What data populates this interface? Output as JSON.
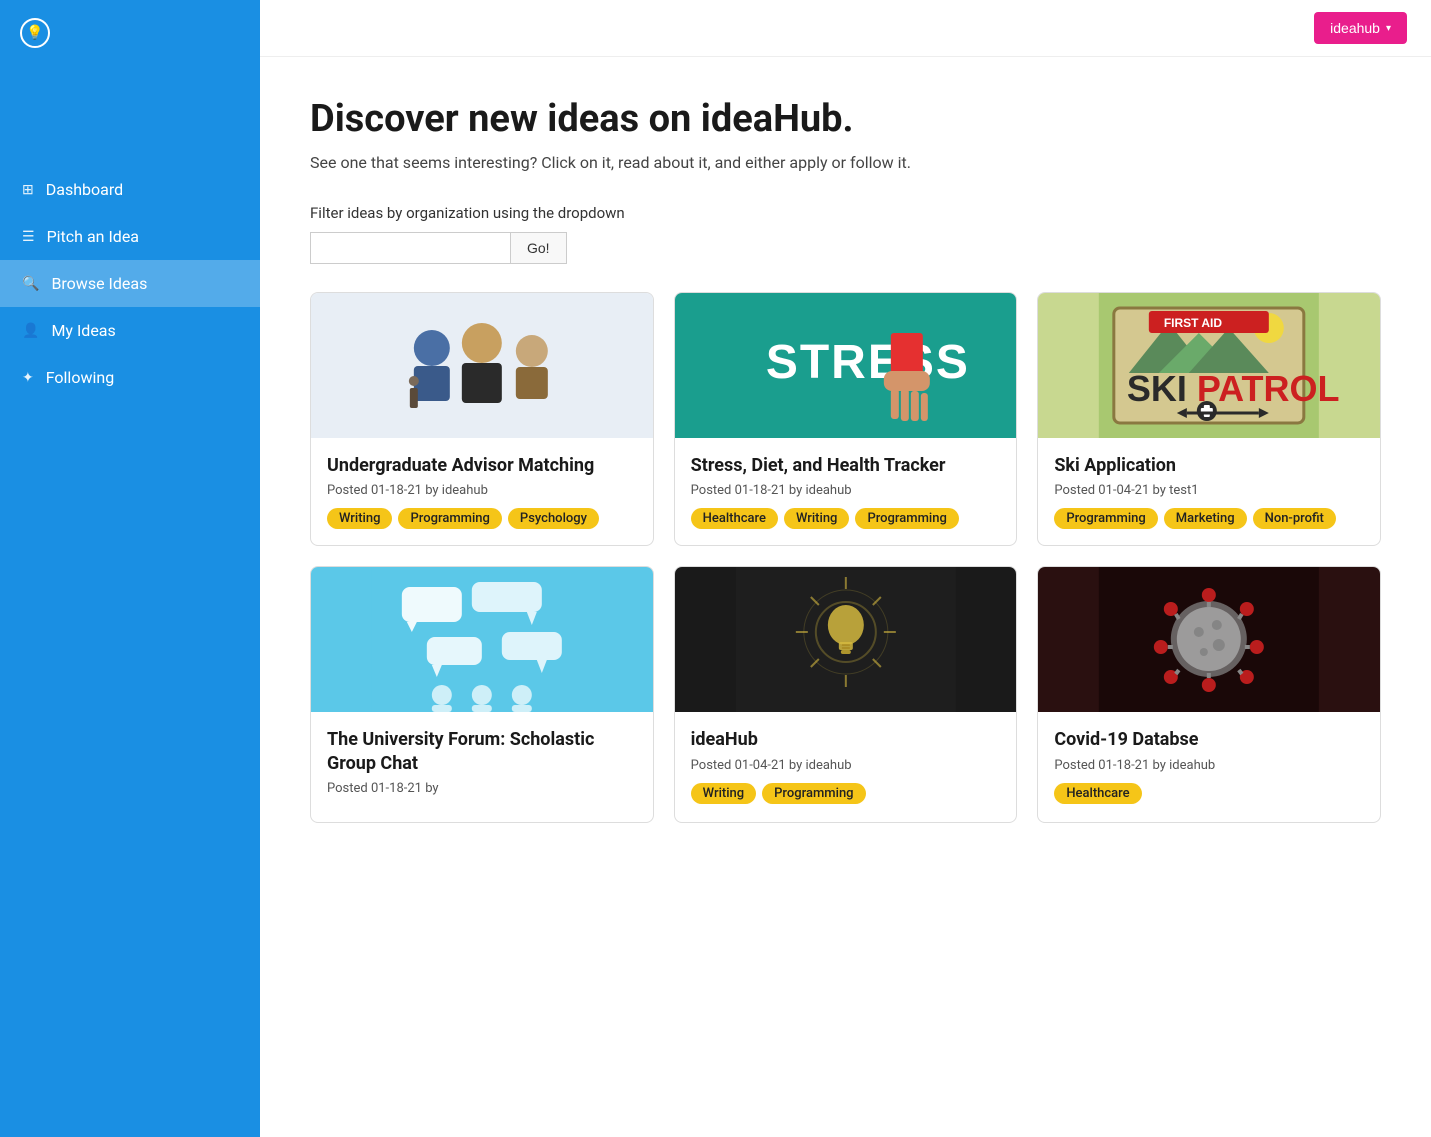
{
  "sidebar": {
    "logo_symbol": "💡",
    "items": [
      {
        "id": "dashboard",
        "label": "Dashboard",
        "icon": "⊞",
        "active": false
      },
      {
        "id": "pitch-idea",
        "label": "Pitch an Idea",
        "icon": "☰",
        "active": false
      },
      {
        "id": "browse-ideas",
        "label": "Browse Ideas",
        "icon": "🔍",
        "active": true
      },
      {
        "id": "my-ideas",
        "label": "My Ideas",
        "icon": "👤",
        "active": false
      },
      {
        "id": "following",
        "label": "Following",
        "icon": "✦",
        "active": false
      }
    ]
  },
  "header": {
    "user_button": "ideahub",
    "dropdown_icon": "▾"
  },
  "main": {
    "title": "Discover new ideas on ideaHub.",
    "subtitle": "See one that seems interesting? Click on it, read about it, and either apply or follow it.",
    "filter_label": "Filter ideas by organization using the dropdown",
    "filter_placeholder": "",
    "filter_button": "Go!",
    "cards": [
      {
        "id": "advisor-matching",
        "title": "Undergraduate Advisor Matching",
        "meta": "Posted 01-18-21 by ideahub",
        "tags": [
          "Writing",
          "Programming",
          "Psychology"
        ],
        "image_type": "advisor"
      },
      {
        "id": "stress-tracker",
        "title": "Stress, Diet, and Health Tracker",
        "meta": "Posted 01-18-21 by ideahub",
        "tags": [
          "Healthcare",
          "Writing",
          "Programming"
        ],
        "image_type": "stress"
      },
      {
        "id": "ski-application",
        "title": "Ski Application",
        "meta": "Posted 01-04-21 by test1",
        "tags": [
          "Programming",
          "Marketing",
          "Non-profit"
        ],
        "image_type": "ski"
      },
      {
        "id": "university-forum",
        "title": "The University Forum: Scholastic Group Chat",
        "meta": "Posted 01-18-21 by",
        "tags": [],
        "image_type": "forum"
      },
      {
        "id": "ideahub",
        "title": "ideaHub",
        "meta": "Posted 01-04-21 by ideahub",
        "tags": [
          "Writing",
          "Programming"
        ],
        "image_type": "ideahub"
      },
      {
        "id": "covid-database",
        "title": "Covid-19 Databse",
        "meta": "Posted 01-18-21 by ideahub",
        "tags": [
          "Healthcare"
        ],
        "image_type": "covid"
      }
    ]
  }
}
